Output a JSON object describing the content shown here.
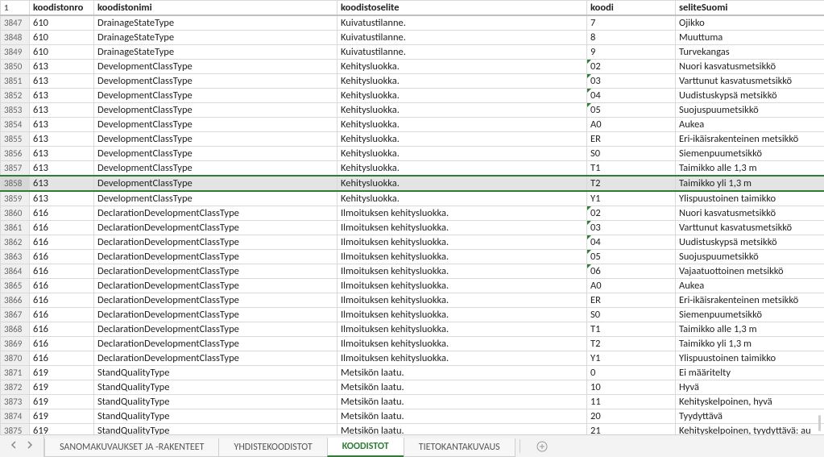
{
  "headers": {
    "rowhead": "1",
    "nro": "koodistonro",
    "nimi": "koodistonimi",
    "selite": "koodistoselite",
    "koodi": "koodi",
    "fi": "seliteSuomi"
  },
  "rows": [
    {
      "n": "3847",
      "nro": "610",
      "nimi": "DrainageStateType",
      "selite": "Kuivatustilanne.",
      "koodi": "7",
      "fi": "Ojikko",
      "flag": false
    },
    {
      "n": "3848",
      "nro": "610",
      "nimi": "DrainageStateType",
      "selite": "Kuivatustilanne.",
      "koodi": "8",
      "fi": "Muuttuma",
      "flag": false
    },
    {
      "n": "3849",
      "nro": "610",
      "nimi": "DrainageStateType",
      "selite": "Kuivatustilanne.",
      "koodi": "9",
      "fi": "Turvekangas",
      "flag": false
    },
    {
      "n": "3850",
      "nro": "613",
      "nimi": "DevelopmentClassType",
      "selite": "Kehitysluokka.",
      "koodi": "02",
      "fi": "Nuori kasvatusmetsikkö",
      "flag": true
    },
    {
      "n": "3851",
      "nro": "613",
      "nimi": "DevelopmentClassType",
      "selite": "Kehitysluokka.",
      "koodi": "03",
      "fi": "Varttunut kasvatusmetsikkö",
      "flag": true
    },
    {
      "n": "3852",
      "nro": "613",
      "nimi": "DevelopmentClassType",
      "selite": "Kehitysluokka.",
      "koodi": "04",
      "fi": "Uudistuskypsä metsikkö",
      "flag": true
    },
    {
      "n": "3853",
      "nro": "613",
      "nimi": "DevelopmentClassType",
      "selite": "Kehitysluokka.",
      "koodi": "05",
      "fi": "Suojuspuumetsikkö",
      "flag": true
    },
    {
      "n": "3854",
      "nro": "613",
      "nimi": "DevelopmentClassType",
      "selite": "Kehitysluokka.",
      "koodi": "A0",
      "fi": "Aukea",
      "flag": false
    },
    {
      "n": "3855",
      "nro": "613",
      "nimi": "DevelopmentClassType",
      "selite": "Kehitysluokka.",
      "koodi": "ER",
      "fi": "Eri-ikäisrakenteinen metsikkö",
      "flag": false
    },
    {
      "n": "3856",
      "nro": "613",
      "nimi": "DevelopmentClassType",
      "selite": "Kehitysluokka.",
      "koodi": "S0",
      "fi": "Siemenpuumetsikkö",
      "flag": false
    },
    {
      "n": "3857",
      "nro": "613",
      "nimi": "DevelopmentClassType",
      "selite": "Kehitysluokka.",
      "koodi": "T1",
      "fi": "Taimikko alle 1,3 m",
      "flag": false
    },
    {
      "n": "3858",
      "nro": "613",
      "nimi": "DevelopmentClassType",
      "selite": "Kehitysluokka.",
      "koodi": "T2",
      "fi": "Taimikko yli 1,3 m",
      "flag": false,
      "selected": true
    },
    {
      "n": "3859",
      "nro": "613",
      "nimi": "DevelopmentClassType",
      "selite": "Kehitysluokka.",
      "koodi": "Y1",
      "fi": "Ylispuustoinen taimikko",
      "flag": false
    },
    {
      "n": "3860",
      "nro": "616",
      "nimi": "DeclarationDevelopmentClassType",
      "selite": "Ilmoituksen kehitysluokka.",
      "koodi": "02",
      "fi": "Nuori kasvatusmetsikkö",
      "flag": true
    },
    {
      "n": "3861",
      "nro": "616",
      "nimi": "DeclarationDevelopmentClassType",
      "selite": "Ilmoituksen kehitysluokka.",
      "koodi": "03",
      "fi": "Varttunut kasvatusmetsikkö",
      "flag": true
    },
    {
      "n": "3862",
      "nro": "616",
      "nimi": "DeclarationDevelopmentClassType",
      "selite": "Ilmoituksen kehitysluokka.",
      "koodi": "04",
      "fi": "Uudistuskypsä metsikkö",
      "flag": true
    },
    {
      "n": "3863",
      "nro": "616",
      "nimi": "DeclarationDevelopmentClassType",
      "selite": "Ilmoituksen kehitysluokka.",
      "koodi": "05",
      "fi": "Suojuspuumetsikkö",
      "flag": true
    },
    {
      "n": "3864",
      "nro": "616",
      "nimi": "DeclarationDevelopmentClassType",
      "selite": "Ilmoituksen kehitysluokka.",
      "koodi": "06",
      "fi": "Vajaatuottoinen metsikkö",
      "flag": true
    },
    {
      "n": "3865",
      "nro": "616",
      "nimi": "DeclarationDevelopmentClassType",
      "selite": "Ilmoituksen kehitysluokka.",
      "koodi": "A0",
      "fi": "Aukea",
      "flag": false
    },
    {
      "n": "3866",
      "nro": "616",
      "nimi": "DeclarationDevelopmentClassType",
      "selite": "Ilmoituksen kehitysluokka.",
      "koodi": "ER",
      "fi": "Eri-ikäisrakenteinen metsikkö",
      "flag": false
    },
    {
      "n": "3867",
      "nro": "616",
      "nimi": "DeclarationDevelopmentClassType",
      "selite": "Ilmoituksen kehitysluokka.",
      "koodi": "S0",
      "fi": "Siemenpuumetsikkö",
      "flag": false
    },
    {
      "n": "3868",
      "nro": "616",
      "nimi": "DeclarationDevelopmentClassType",
      "selite": "Ilmoituksen kehitysluokka.",
      "koodi": "T1",
      "fi": "Taimikko alle 1,3 m",
      "flag": false
    },
    {
      "n": "3869",
      "nro": "616",
      "nimi": "DeclarationDevelopmentClassType",
      "selite": "Ilmoituksen kehitysluokka.",
      "koodi": "T2",
      "fi": "Taimikko yli 1,3 m",
      "flag": false
    },
    {
      "n": "3870",
      "nro": "616",
      "nimi": "DeclarationDevelopmentClassType",
      "selite": "Ilmoituksen kehitysluokka.",
      "koodi": "Y1",
      "fi": "Ylispuustoinen taimikko",
      "flag": false
    },
    {
      "n": "3871",
      "nro": "619",
      "nimi": "StandQualityType",
      "selite": "Metsikön laatu.",
      "koodi": "0",
      "fi": "Ei määritelty",
      "flag": false
    },
    {
      "n": "3872",
      "nro": "619",
      "nimi": "StandQualityType",
      "selite": "Metsikön laatu.",
      "koodi": "10",
      "fi": "Hyvä",
      "flag": false
    },
    {
      "n": "3873",
      "nro": "619",
      "nimi": "StandQualityType",
      "selite": "Metsikön laatu.",
      "koodi": "11",
      "fi": "Kehityskelpoinen, hyvä",
      "flag": false
    },
    {
      "n": "3874",
      "nro": "619",
      "nimi": "StandQualityType",
      "selite": "Metsikön laatu.",
      "koodi": "20",
      "fi": "Tyydyttävä",
      "flag": false
    },
    {
      "n": "3875",
      "nro": "619",
      "nimi": "StandQualityType",
      "selite": "Metsikön laatu.",
      "koodi": "21",
      "fi": "Kehityskelpoinen, tyydyttävä: au",
      "flag": false
    }
  ],
  "tabs": {
    "items": [
      "SANOMAKUVAUKSET JA -RAKENTEET",
      "YHDISTEKOODISTOT",
      "KOODISTOT",
      "TIETOKANTAKUVAUS"
    ],
    "active": 2
  }
}
